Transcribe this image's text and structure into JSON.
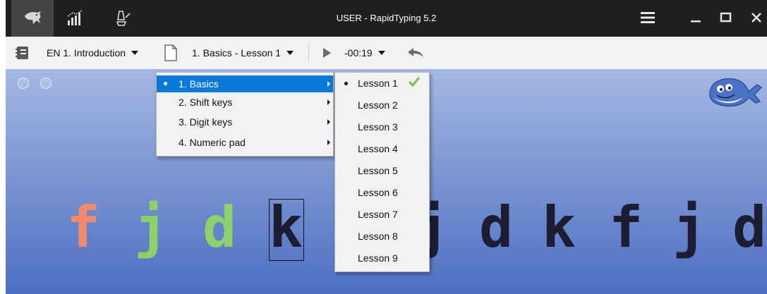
{
  "window": {
    "title": "USER - RapidTyping 5.2"
  },
  "titlebar": {
    "tabs": [
      {
        "icon": "rabbit-icon",
        "active": true
      },
      {
        "icon": "statistics-icon",
        "active": false
      },
      {
        "icon": "editor-icon",
        "active": false
      }
    ],
    "controls": [
      "menu-icon",
      "minimize-icon",
      "maximize-icon",
      "close-icon"
    ]
  },
  "toolbar": {
    "course_label": "EN 1. Introduction",
    "lesson_label": "1. Basics - Lesson 1",
    "timer_label": "-00:19"
  },
  "exercise": {
    "letters": [
      {
        "char": "f",
        "state": "error",
        "color": "#f28a6b"
      },
      {
        "char": "j",
        "state": "correct",
        "color": "#8fd169"
      },
      {
        "char": "d",
        "state": "correct",
        "color": "#8fd169"
      },
      {
        "char": "k",
        "state": "current",
        "color": "#1c1d33"
      },
      {
        "char": "j",
        "state": "pending",
        "color": "#1c1d33"
      },
      {
        "char": "d",
        "state": "pending",
        "color": "#1c1d33"
      },
      {
        "char": "k",
        "state": "pending",
        "color": "#1c1d33"
      },
      {
        "char": "f",
        "state": "pending",
        "color": "#1c1d33"
      },
      {
        "char": "j",
        "state": "pending",
        "color": "#1c1d33"
      },
      {
        "char": "d",
        "state": "pending",
        "color": "#1c1d33"
      }
    ]
  },
  "menu": {
    "sections": [
      {
        "label": "1. Basics",
        "selected": true
      },
      {
        "label": "2. Shift keys",
        "selected": false
      },
      {
        "label": "3. Digit keys",
        "selected": false
      },
      {
        "label": "4. Numeric pad",
        "selected": false
      }
    ],
    "lessons": [
      {
        "label": "Lesson 1",
        "current": true,
        "completed": true
      },
      {
        "label": "Lesson 2",
        "current": false,
        "completed": false
      },
      {
        "label": "Lesson 3",
        "current": false,
        "completed": false
      },
      {
        "label": "Lesson 4",
        "current": false,
        "completed": false
      },
      {
        "label": "Lesson 5",
        "current": false,
        "completed": false
      },
      {
        "label": "Lesson 6",
        "current": false,
        "completed": false
      },
      {
        "label": "Lesson 7",
        "current": false,
        "completed": false
      },
      {
        "label": "Lesson 8",
        "current": false,
        "completed": false
      },
      {
        "label": "Lesson 9",
        "current": false,
        "completed": false
      }
    ]
  },
  "colors": {
    "selection": "#0a78d7",
    "check": "#6cc84a",
    "titlebar": "#1f1f1f"
  }
}
